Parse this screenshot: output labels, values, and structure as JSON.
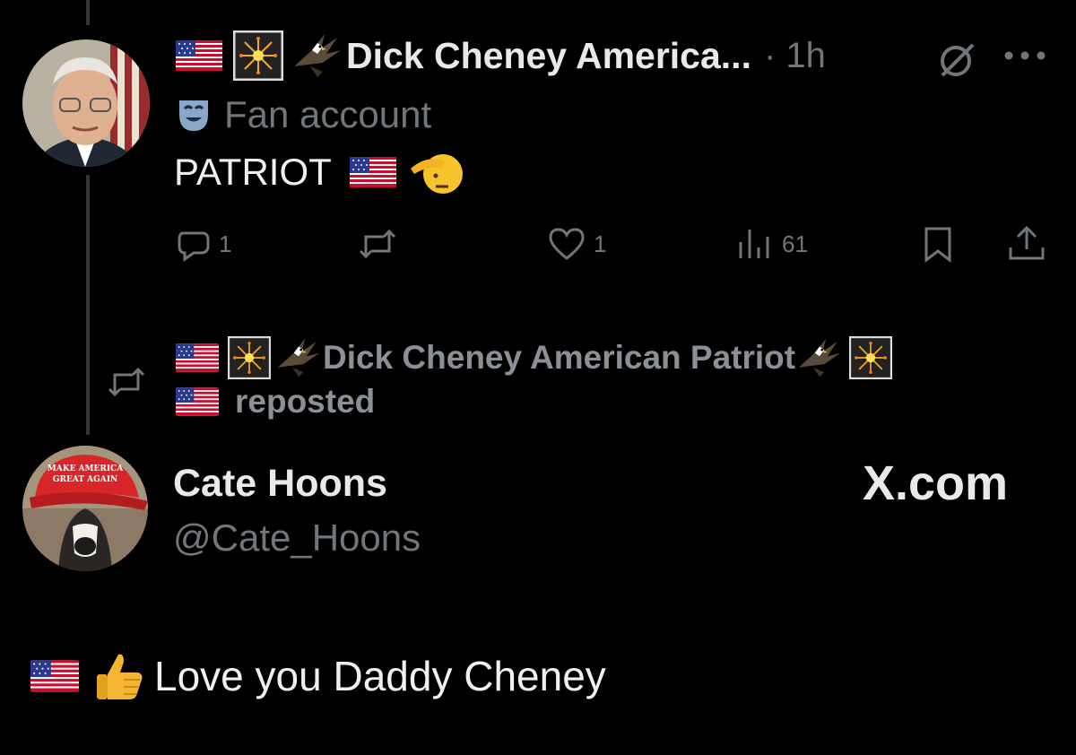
{
  "tweet": {
    "display_name": "Dick Cheney America...",
    "time": "· 1h",
    "label": "Fan account",
    "text": "PATRIOT",
    "stats": {
      "replies": "1",
      "reposts": "",
      "likes": "1",
      "views": "61"
    }
  },
  "repost": {
    "name": "Dick Cheney American Patriot",
    "label": "reposted"
  },
  "quoted": {
    "display_name": "Cate Hoons",
    "handle": "@Cate_Hoons",
    "watermark": "X.com",
    "text": "Love you Daddy Cheney",
    "avatar_cap_text": "MAKE AMERICA GREAT AGAIN"
  },
  "icons": [
    "flag-usa-icon",
    "fireworks-icon",
    "eagle-icon",
    "theater-mask-icon",
    "salute-icon",
    "reply-icon",
    "repost-icon",
    "like-icon",
    "views-icon",
    "bookmark-icon",
    "share-icon",
    "grok-icon",
    "more-icon",
    "thumbs-up-icon"
  ],
  "colors": {
    "background": "#000000",
    "text": "#e7e9ea",
    "muted": "#71767b",
    "thread_line": "#333639"
  }
}
